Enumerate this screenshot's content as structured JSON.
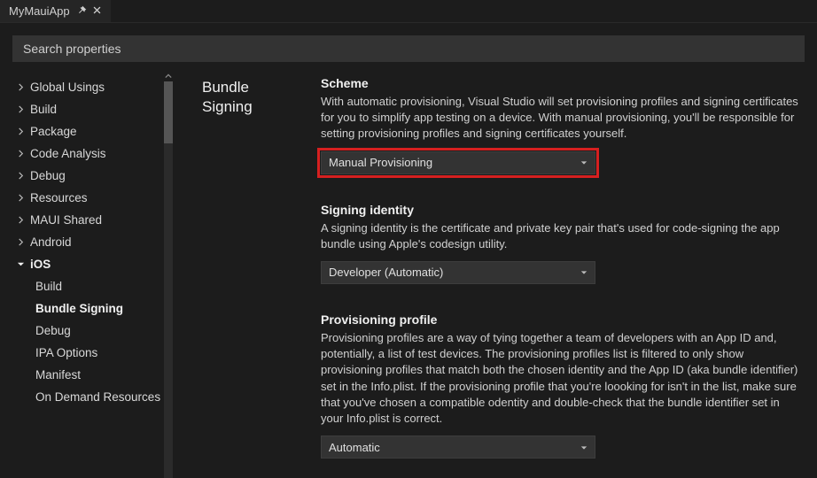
{
  "tab": {
    "title": "MyMauiApp"
  },
  "search": {
    "placeholder": "Search properties"
  },
  "sidebar": {
    "items": [
      {
        "label": "Global Usings",
        "expanded": false,
        "sub": false
      },
      {
        "label": "Build",
        "expanded": false,
        "sub": false
      },
      {
        "label": "Package",
        "expanded": false,
        "sub": false
      },
      {
        "label": "Code Analysis",
        "expanded": false,
        "sub": false
      },
      {
        "label": "Debug",
        "expanded": false,
        "sub": false
      },
      {
        "label": "Resources",
        "expanded": false,
        "sub": false
      },
      {
        "label": "MAUI Shared",
        "expanded": false,
        "sub": false
      },
      {
        "label": "Android",
        "expanded": false,
        "sub": false
      },
      {
        "label": "iOS",
        "expanded": true,
        "sub": false,
        "bold": true
      },
      {
        "label": "Build",
        "sub": true
      },
      {
        "label": "Bundle Signing",
        "sub": true,
        "bold": true
      },
      {
        "label": "Debug",
        "sub": true
      },
      {
        "label": "IPA Options",
        "sub": true
      },
      {
        "label": "Manifest",
        "sub": true
      },
      {
        "label": "On Demand Resources",
        "sub": true
      }
    ]
  },
  "section": {
    "title_line1": "Bundle",
    "title_line2": "Signing"
  },
  "scheme": {
    "label": "Scheme",
    "desc": "With automatic provisioning, Visual Studio will set provisioning profiles and signing certificates for you to simplify app testing on a device. With manual provisioning, you'll be responsible for setting provisioning profiles and signing certificates yourself.",
    "value": "Manual Provisioning"
  },
  "identity": {
    "label": "Signing identity",
    "desc": "A signing identity is the certificate and private key pair that's used for code-signing the app bundle using Apple's codesign utility.",
    "value": "Developer (Automatic)"
  },
  "profile": {
    "label": "Provisioning profile",
    "desc": "Provisioning profiles are a way of tying together a team of developers with an App ID and, potentially, a list of test devices. The provisioning profiles list is filtered to only show provisioning profiles that match both the chosen identity and the App ID (aka bundle identifier) set in the Info.plist. If the provisioning profile that you're loooking for isn't in the list, make sure that you've chosen a compatible odentity and double-check that the bundle identifier set in your Info.plist is correct.",
    "value": "Automatic"
  }
}
